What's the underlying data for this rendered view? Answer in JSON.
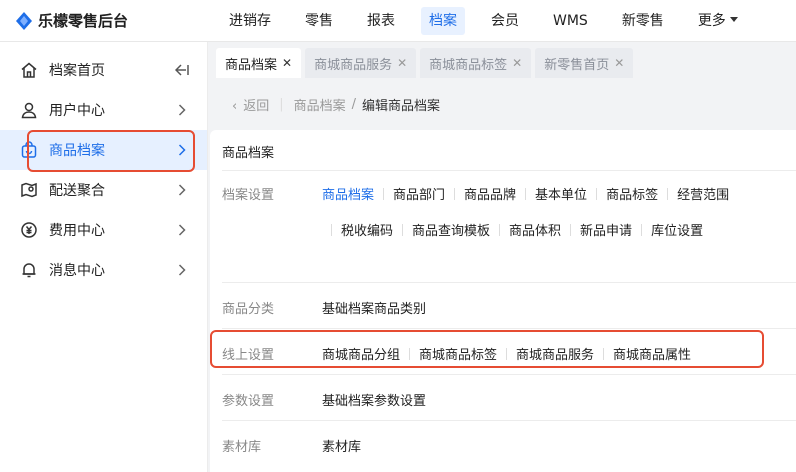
{
  "app": {
    "title": "乐檬零售后台"
  },
  "topnav": {
    "items": [
      "进销存",
      "零售",
      "报表",
      "档案",
      "会员",
      "WMS",
      "新零售"
    ],
    "more": "更多"
  },
  "sidebar": {
    "items": [
      {
        "label": "档案首页",
        "icon": "home-icon"
      },
      {
        "label": "用户中心",
        "icon": "user-icon"
      },
      {
        "label": "商品档案",
        "icon": "bag-icon"
      },
      {
        "label": "配送聚合",
        "icon": "map-pin-icon"
      },
      {
        "label": "费用中心",
        "icon": "yen-icon"
      },
      {
        "label": "消息中心",
        "icon": "bell-icon"
      }
    ]
  },
  "tabs": [
    {
      "label": "商品档案"
    },
    {
      "label": "商城商品服务"
    },
    {
      "label": "商城商品标签"
    },
    {
      "label": "新零售首页"
    }
  ],
  "breadcrumb": {
    "back": "返回",
    "parent": "商品档案",
    "separator": "/",
    "current": "编辑商品档案"
  },
  "card": {
    "title": "商品档案",
    "archive_settings": {
      "label": "档案设置",
      "links": [
        "商品档案",
        "商品部门",
        "商品品牌",
        "基本单位",
        "商品标签",
        "经营范围",
        "税收编码",
        "商品查询模板",
        "商品体积",
        "新品申请",
        "库位设置"
      ]
    },
    "category": {
      "label": "商品分类",
      "links": [
        "基础档案商品类别"
      ]
    },
    "online": {
      "label": "线上设置",
      "links": [
        "商城商品分组",
        "商城商品标签",
        "商城商品服务",
        "商城商品属性"
      ]
    },
    "params": {
      "label": "参数设置",
      "links": [
        "基础档案参数设置"
      ]
    },
    "materials": {
      "label": "素材库",
      "links": [
        "素材库"
      ]
    }
  },
  "colors": {
    "accent": "#1e6ee8",
    "highlight": "#e64c33",
    "active_bg": "#e6f0ff"
  }
}
